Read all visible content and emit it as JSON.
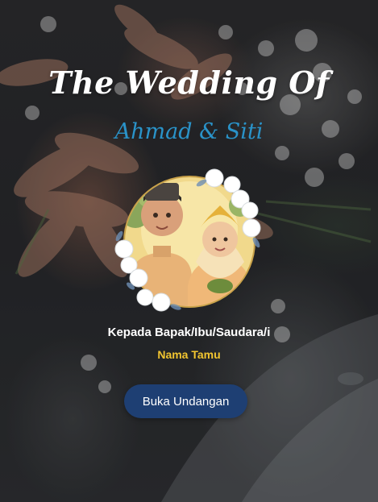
{
  "cover": {
    "title": "The Wedding Of",
    "couple_names": "Ahmad & Siti",
    "guest_label": "Kepada Bapak/Ibu/Saudara/i",
    "guest_name": "Nama Tamu",
    "open_button_label": "Buka Undangan"
  },
  "colors": {
    "title": "#ffffff",
    "couple_names": "#2a93c9",
    "guest_name": "#f2c530",
    "button_bg": "#1e3f73"
  }
}
